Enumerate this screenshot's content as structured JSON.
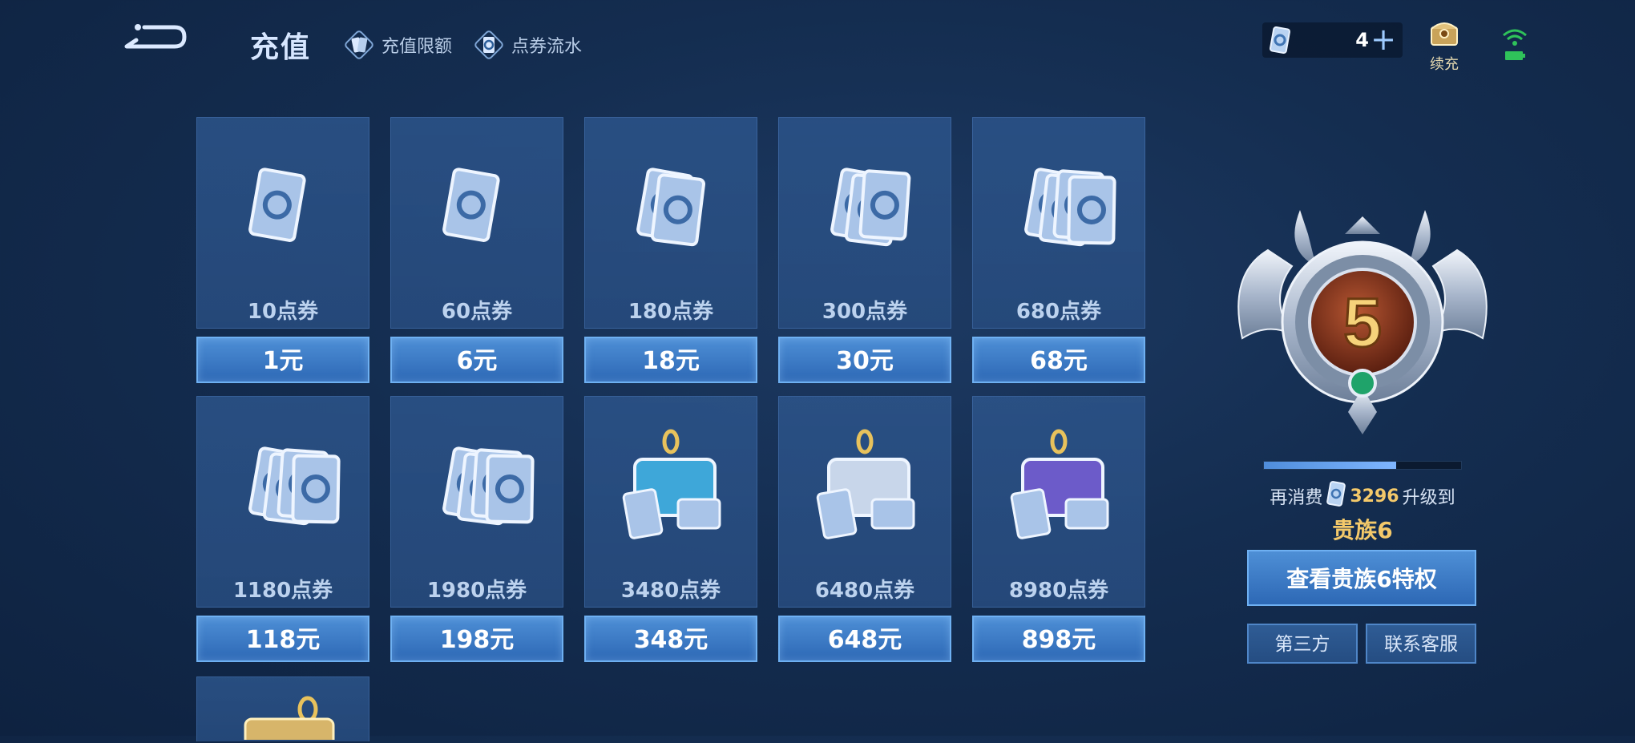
{
  "header": {
    "title": "充值",
    "links": [
      {
        "label": "充值限额",
        "icon": "voucher-cards-icon"
      },
      {
        "label": "点券流水",
        "icon": "voucher-flow-icon"
      }
    ],
    "balance": "4",
    "renew_label": "续充"
  },
  "packages": [
    {
      "amount": "10点券",
      "price": "1元"
    },
    {
      "amount": "60点券",
      "price": "6元"
    },
    {
      "amount": "180点券",
      "price": "18元"
    },
    {
      "amount": "300点券",
      "price": "30元"
    },
    {
      "amount": "680点券",
      "price": "68元"
    },
    {
      "amount": "1180点券",
      "price": "118元"
    },
    {
      "amount": "1980点券",
      "price": "198元"
    },
    {
      "amount": "3480点券",
      "price": "348元"
    },
    {
      "amount": "6480点券",
      "price": "648元"
    },
    {
      "amount": "8980点券",
      "price": "898元"
    }
  ],
  "noble": {
    "level": "5",
    "progress": 0.67,
    "prefix": "再消费",
    "needed": "3296",
    "suffix": "升级到",
    "next_level": "贵族6",
    "privilege_button": "查看贵族6特权",
    "third_party_button": "第三方",
    "support_button": "联系客服"
  },
  "colors": {
    "accent": "#4e8fd6",
    "gold": "#f4c96a",
    "background": "#142d50"
  }
}
